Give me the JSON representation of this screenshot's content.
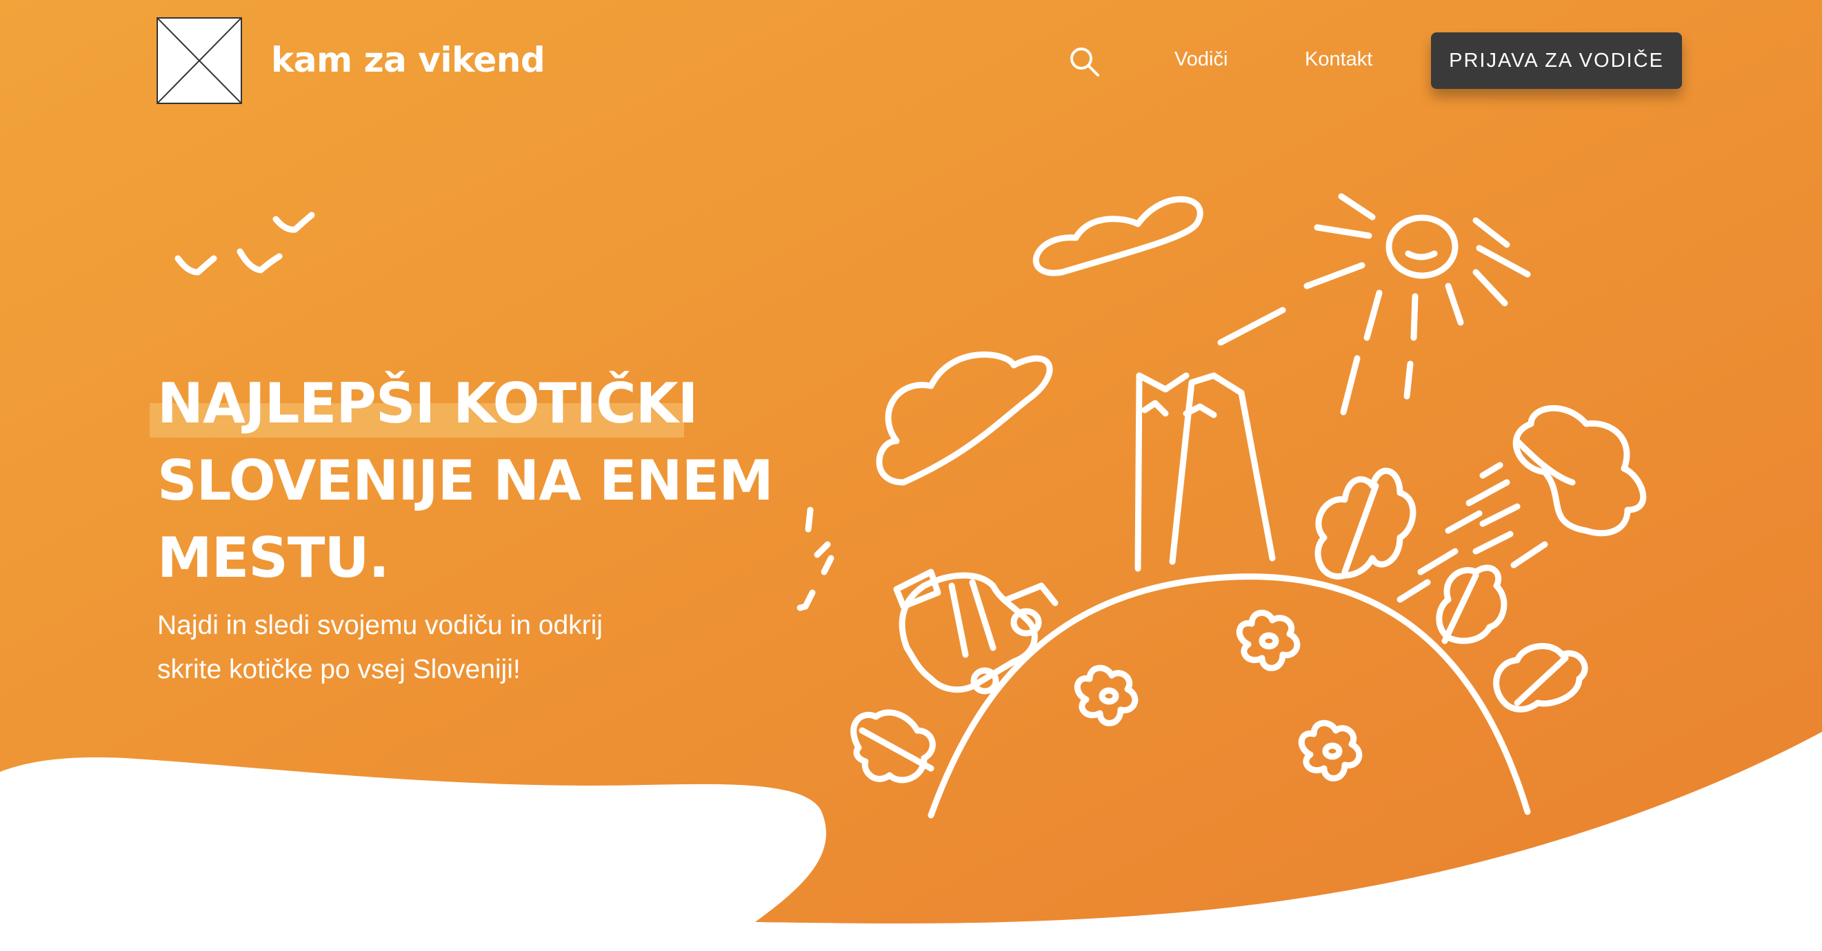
{
  "brand": {
    "name": "kam za vikend"
  },
  "nav": {
    "search_icon": "search-icon",
    "links": [
      "Vodiči",
      "Kontakt"
    ],
    "cta_label": "PRIJAVA ZA VODIČE"
  },
  "hero": {
    "headline_lines": [
      "NAJLEPŠI KOTIČKI",
      "SLOVENIJE NA ENEM",
      "MESTU."
    ],
    "subtitle_lines": [
      "Najdi in sledi svojemu vodiču in odkrij",
      "skrite kotičke po vsej Sloveniji!"
    ]
  },
  "colors": {
    "gradient_start": "#f2a33a",
    "gradient_end": "#e9822f",
    "cta_background": "#3a3a3a",
    "highlight": "#f3b55e",
    "text": "#ffffff"
  }
}
